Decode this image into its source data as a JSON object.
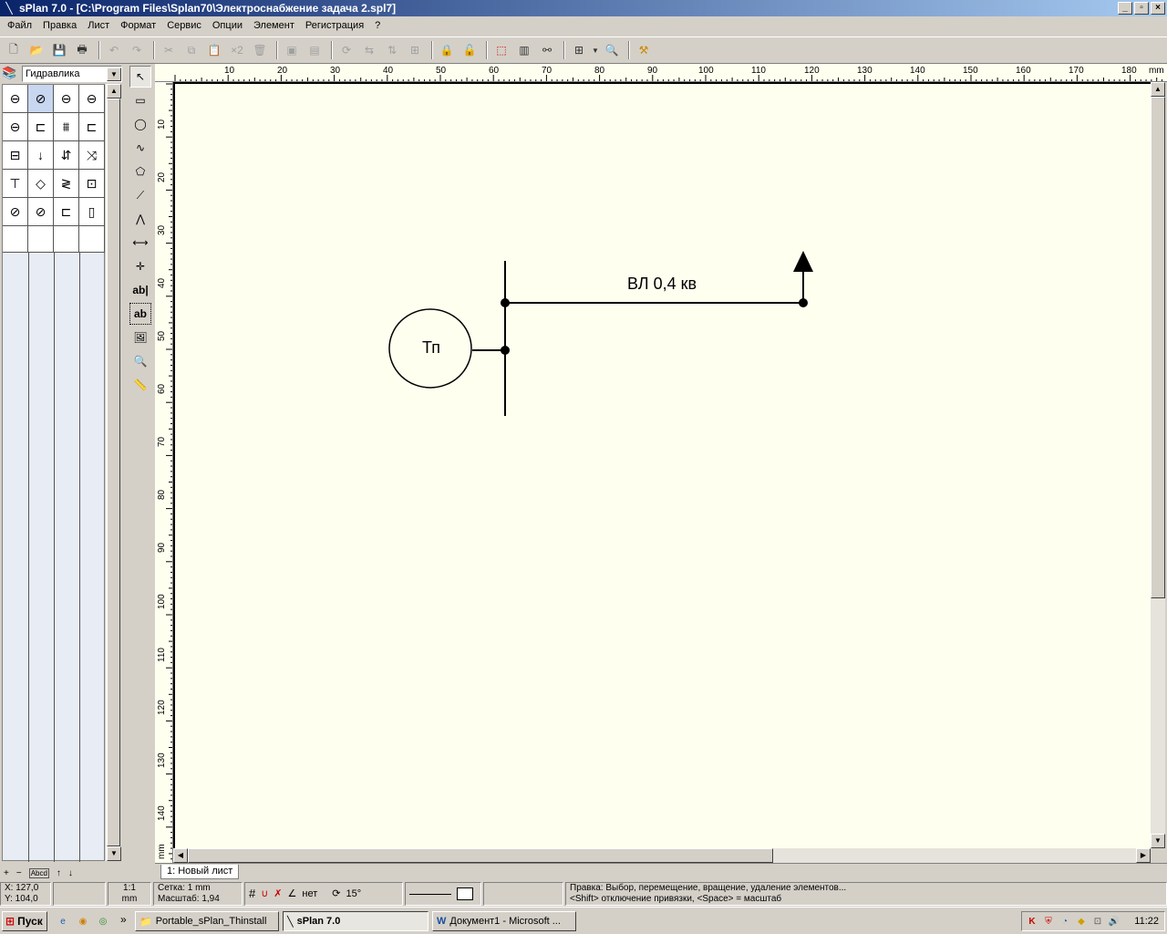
{
  "window": {
    "title": "sPlan 7.0 - [C:\\Program Files\\Splan70\\Электроснабжение задача 2.spl7]",
    "minimize": "_",
    "restore": "▫",
    "close": "×"
  },
  "menu": [
    "Файл",
    "Правка",
    "Лист",
    "Формат",
    "Сервис",
    "Опции",
    "Элемент",
    "Регистрация",
    "?"
  ],
  "toolbar": {
    "zoom_x2": "×2"
  },
  "library": {
    "selected": "Гидравлика",
    "footer": [
      "+",
      "−",
      "Abcd",
      "↑",
      "↓"
    ]
  },
  "tools": {
    "text_tool_1": "ab|",
    "text_tool_2": "ab"
  },
  "rulers": {
    "h_ticks": [
      "10",
      "20",
      "30",
      "40",
      "50",
      "60",
      "70",
      "80",
      "90",
      "100",
      "110",
      "120",
      "130",
      "140",
      "150",
      "160",
      "170",
      "180"
    ],
    "h_unit": "mm",
    "v_ticks": [
      "10",
      "20",
      "30",
      "40",
      "50",
      "60",
      "70",
      "80",
      "90",
      "100",
      "110",
      "120",
      "130",
      "140"
    ],
    "v_unit": "mm"
  },
  "drawing": {
    "transformer_label": "Тп",
    "line_label": "ВЛ 0,4 кв"
  },
  "sheet_tab": "1: Новый лист",
  "status": {
    "x": "X: 127,0",
    "y": "Y: 104,0",
    "scale_ratio": "1:1",
    "scale_unit": "mm",
    "grid": "Сетка: 1 mm",
    "zoom": "Масштаб:   1,94",
    "snap": "нет",
    "angle": "15°",
    "hint1": "Правка: Выбор, перемещение, вращение, удаление элементов...",
    "hint2": "<Shift> отключение привязки, <Space> = масштаб"
  },
  "taskbar": {
    "start": "Пуск",
    "tasks": [
      "Portable_sPlan_Thinstall",
      "sPlan 7.0",
      "Документ1 - Microsoft ..."
    ],
    "clock": "11:22"
  }
}
